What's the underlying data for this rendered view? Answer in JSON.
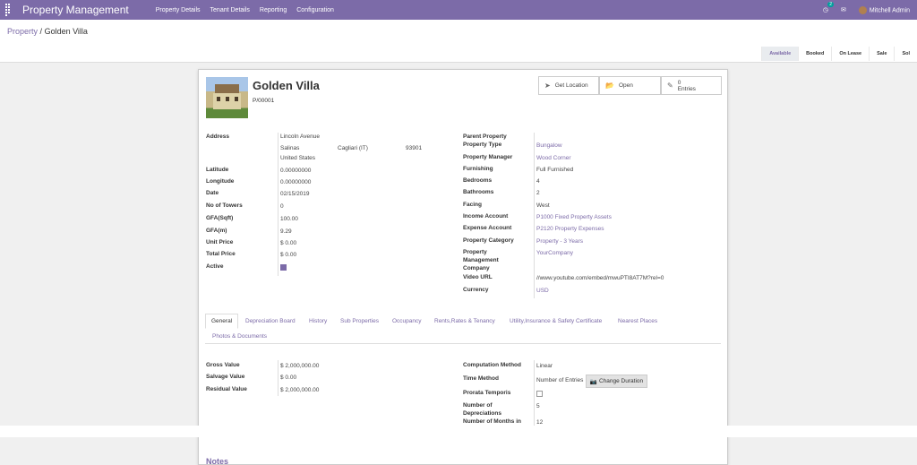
{
  "navbar": {
    "brand": "Property Management",
    "menu": [
      "Property Details",
      "Tenant Details",
      "Reporting",
      "Configuration"
    ],
    "notif_count": "2",
    "user": "Mitchell Admin"
  },
  "breadcrumb": {
    "parent": "Property",
    "separator": "/",
    "current": "Golden Villa"
  },
  "status": [
    "Available",
    "Booked",
    "On Lease",
    "Sale",
    "Sol"
  ],
  "header": {
    "title": "Golden Villa",
    "ref": "P/00001"
  },
  "smart_buttons": {
    "location": "Get Location",
    "open": "Open",
    "entries_count": "0",
    "entries_label": "Entries"
  },
  "left_fields": {
    "address_label": "Address",
    "street": "Lincoln Avenue",
    "city": "Salinas",
    "state": "Cagliari (IT)",
    "zip": "93901",
    "country": "United States",
    "latitude_label": "Latitude",
    "latitude": "0.00000000",
    "longitude_label": "Longitude",
    "longitude": "0.00000000",
    "date_label": "Date",
    "date": "02/15/2019",
    "towers_label": "No of Towers",
    "towers": "0",
    "gfa_sqft_label": "GFA(Sqft)",
    "gfa_sqft": "100.00",
    "gfa_m_label": "GFA(m)",
    "gfa_m": "9.29",
    "unit_price_label": "Unit Price",
    "unit_price": "$ 0.00",
    "total_price_label": "Total Price",
    "total_price": "$ 0.00",
    "active_label": "Active"
  },
  "right_fields": {
    "parent_label": "Parent Property",
    "type_label": "Property Type",
    "type": "Bungalow",
    "manager_label": "Property Manager",
    "manager": "Wood Corner",
    "furnishing_label": "Furnishing",
    "furnishing": "Full Furnished",
    "bedrooms_label": "Bedrooms",
    "bedrooms": "4",
    "bathrooms_label": "Bathrooms",
    "bathrooms": "2",
    "facing_label": "Facing",
    "facing": "West",
    "income_label": "Income Account",
    "income": "P1000 Fixed Property Assets",
    "expense_label": "Expense Account",
    "expense": "P2120 Property Expenses",
    "category_label": "Property Category",
    "category": "Property - 3 Years",
    "company_label_1": "Property",
    "company_label_2": "Management",
    "company_label_3": "Company",
    "company": "YourCompany",
    "video_label": "Video URL",
    "video": "//www.youtube.com/embed/mwuPTI8AT7M?rel=0",
    "currency_label": "Currency",
    "currency": "USD"
  },
  "tabs": [
    "General",
    "Depreciation Board",
    "History",
    "Sub Properties",
    "Occupancy",
    "Rents,Rates & Tenancy",
    "Utility,Insurance & Safety Certificate",
    "Nearest Places",
    "Photos & Documents"
  ],
  "general": {
    "gross_label": "Gross Value",
    "gross": "$ 2,000,000.00",
    "salvage_label": "Salvage Value",
    "salvage": "$ 0.00",
    "residual_label": "Residual Value",
    "residual": "$ 2,000,000.00",
    "comp_label": "Computation Method",
    "comp": "Linear",
    "time_label": "Time Method",
    "time": "Number of Entries",
    "change_duration": "Change Duration",
    "prorata_label": "Prorata Temporis",
    "ndep_label_1": "Number of",
    "ndep_label_2": "Depreciations",
    "ndep": "5",
    "months_label": "Number of Months in",
    "months": "12"
  },
  "notes_title": "Notes",
  "colors": {
    "brand": "#7c6ba8",
    "badge": "#00a09d"
  }
}
